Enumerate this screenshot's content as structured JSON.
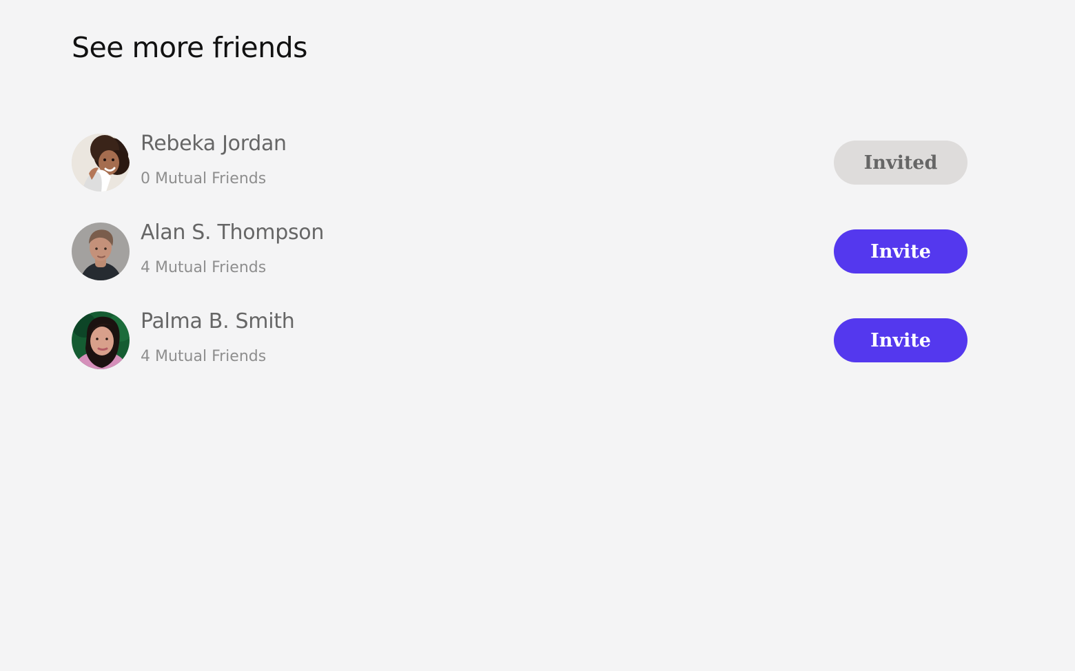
{
  "page": {
    "title": "See more friends"
  },
  "colors": {
    "background": "#f4f4f5",
    "primary": "#5438ee",
    "invited_button": "#dedcdb",
    "name_text": "#666666",
    "secondary_text": "#8e8e8e"
  },
  "friends": [
    {
      "name": "Rebeka Jordan",
      "mutual_friends": "0 Mutual Friends",
      "button_label": "Invited",
      "status": "invited",
      "avatar_icon": "woman-curly-hair-avatar"
    },
    {
      "name": "Alan S. Thompson",
      "mutual_friends": "4 Mutual Friends",
      "button_label": "Invite",
      "status": "invite",
      "avatar_icon": "man-avatar"
    },
    {
      "name": "Palma B. Smith",
      "mutual_friends": "4 Mutual Friends",
      "button_label": "Invite",
      "status": "invite",
      "avatar_icon": "woman-dark-hair-avatar"
    }
  ]
}
